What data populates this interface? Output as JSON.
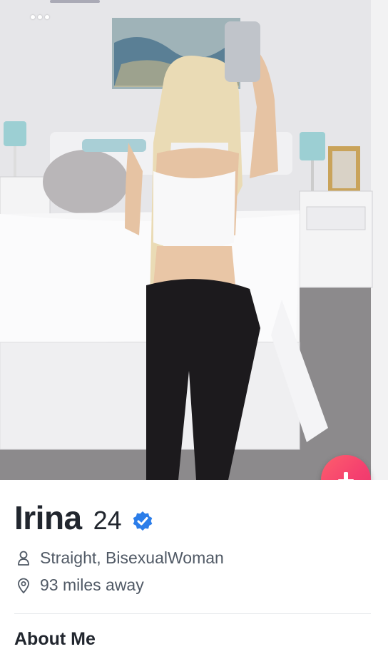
{
  "profile": {
    "name": "Irina",
    "age": "24",
    "orientation": "Straight, BisexualWoman",
    "distance": "93 miles away"
  },
  "sections": {
    "about_title": "About Me"
  },
  "icons": {
    "more": "more-dots-icon",
    "collapse": "arrow-down-icon",
    "verified": "verified-badge-icon",
    "orientation": "person-icon",
    "location": "location-pin-icon"
  },
  "colors": {
    "accent": "#fd5068",
    "verified": "#2b7de9",
    "text_primary": "#21262e",
    "text_secondary": "#505965"
  }
}
